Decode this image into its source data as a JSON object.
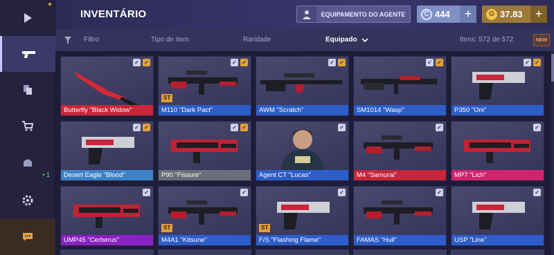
{
  "header": {
    "title": "INVENTÁRIO",
    "agent_button": "EQUIPAMENTO DO AGENTE",
    "currency_silver": "444",
    "currency_gold": "37.83",
    "currency_silver_symbol": "C",
    "currency_gold_symbol": "G",
    "plus": "+"
  },
  "filters": {
    "filter": "Filtro",
    "item_type": "Tipo de item",
    "rarity": "Raridade",
    "equipped": "Equipado",
    "items_count": "Itens: 572 de 572",
    "new_badge": "NEW"
  },
  "sidebar": {
    "badge": "• 1"
  },
  "colors": {
    "red": "#c8263a",
    "blue": "#2d5dc8",
    "light_blue": "#3a84c7",
    "gray": "#6b6e7a",
    "pink": "#d0246e",
    "purple": "#8a21c2",
    "gold": "#e1a43a"
  },
  "cards": [
    {
      "name": "Butterfly \"Black Widow\"",
      "rarity": "red",
      "checks": [
        "white",
        "gold"
      ],
      "st": "",
      "icon": "knife"
    },
    {
      "name": "M110 \"Dark Pact\"",
      "rarity": "blue",
      "checks": [
        "white",
        "gold"
      ],
      "st": "ST",
      "icon": "rifle"
    },
    {
      "name": "AWM \"Scratch\"",
      "rarity": "blue",
      "checks": [
        "white",
        "gold"
      ],
      "st": "",
      "icon": "sniper"
    },
    {
      "name": "SM1014 \"Wasp\"",
      "rarity": "blue",
      "checks": [
        "white",
        "gold"
      ],
      "st": "",
      "icon": "shotgun"
    },
    {
      "name": "P350 \"Oni\"",
      "rarity": "blue",
      "checks": [
        "white",
        "gold"
      ],
      "st": "",
      "icon": "pistol"
    },
    {
      "name": "Desert Eagle \"Blood\"",
      "rarity": "light_blue",
      "checks": [
        "white",
        "gold"
      ],
      "st": "",
      "icon": "pistol"
    },
    {
      "name": "P90 \"Fissure\"",
      "rarity": "gray",
      "checks": [
        "white",
        "gold"
      ],
      "st": "",
      "icon": "smg"
    },
    {
      "name": "Agent CT \"Lucas\"",
      "rarity": "blue",
      "checks": [
        "white"
      ],
      "st": "",
      "icon": "agent"
    },
    {
      "name": "M4 \"Samurai\"",
      "rarity": "red",
      "checks": [
        "white"
      ],
      "st": "",
      "icon": "rifle"
    },
    {
      "name": "MP7 \"Lich\"",
      "rarity": "pink",
      "checks": [
        "white"
      ],
      "st": "",
      "icon": "smg"
    },
    {
      "name": "UMP45 \"Cerberus\"",
      "rarity": "purple",
      "checks": [
        "white"
      ],
      "st": "",
      "icon": "smg"
    },
    {
      "name": "M4A1 \"Kitsune\"",
      "rarity": "blue",
      "checks": [
        "white"
      ],
      "st": "ST",
      "icon": "rifle"
    },
    {
      "name": "F/S \"Flashing Flame\"",
      "rarity": "blue",
      "checks": [
        "white"
      ],
      "st": "ST",
      "icon": "pistol"
    },
    {
      "name": "FAMAS \"Hull\"",
      "rarity": "blue",
      "checks": [
        "white"
      ],
      "st": "",
      "icon": "rifle"
    },
    {
      "name": "USP \"Line\"",
      "rarity": "blue",
      "checks": [
        "white"
      ],
      "st": "",
      "icon": "pistol"
    }
  ]
}
